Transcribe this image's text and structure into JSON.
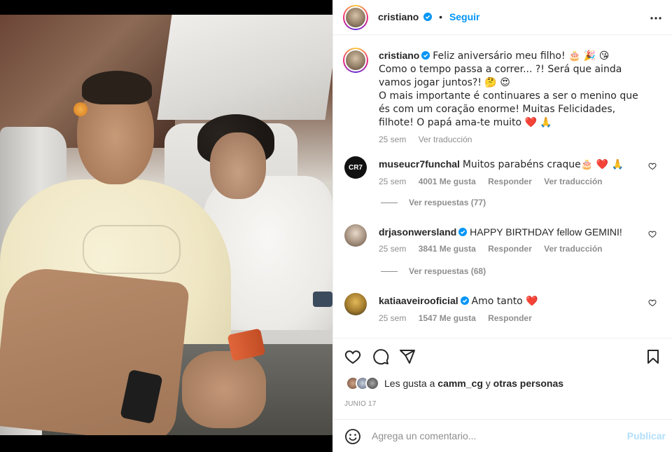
{
  "post": {
    "photo_alt": "",
    "author": "cristiano",
    "follow_label": "Seguir",
    "separator": "•",
    "caption": {
      "line1": "Feliz aniversário meu filho! 🎂 🎉 😘",
      "line2": "Como o tempo passa a correr... ?! Será que ainda vamos jogar juntos?! 🤔 😍",
      "line3": "O mais importante é continuares a ser o menino que és com um coração enorme! Muitas Felicidades, filhote! O papá ama-te muito ❤️ 🙏",
      "time": "25 sem",
      "translate": "Ver traducción"
    },
    "comments": [
      {
        "username": "museucr7funchal",
        "verified": false,
        "avatar_text": "CR7",
        "text": "Muitos parabéns craque🎂 ❤️ 🙏",
        "time": "25 sem",
        "likes": "4001 Me gusta",
        "reply": "Responder",
        "translate": "Ver traducción",
        "replies": "Ver respuestas (77)"
      },
      {
        "username": "drjasonwersland",
        "verified": true,
        "text": "HAPPY BIRTHDAY fellow GEMINI!",
        "time": "25 sem",
        "likes": "3841 Me gusta",
        "reply": "Responder",
        "translate": "Ver traducción",
        "replies": "Ver respuestas (68)"
      },
      {
        "username": "katiaaveirooficial",
        "verified": true,
        "text": "Amo tanto ❤️",
        "time": "25 sem",
        "likes": "1547 Me gusta",
        "reply": "Responder"
      }
    ],
    "likes": {
      "prefix": "Les gusta a",
      "user": "camm_cg",
      "conj": "y",
      "others": "otras personas"
    },
    "date": "JUNIO 17",
    "add_comment": {
      "placeholder": "Agrega un comentario...",
      "publish": "Publicar"
    }
  },
  "icons": {
    "verified": "verified-icon",
    "more": "more-icon",
    "heart": "heart-icon",
    "comment": "comment-icon",
    "share": "share-icon",
    "save": "bookmark-icon",
    "emoji": "emoji-icon"
  },
  "colors": {
    "accent": "#0095f6",
    "verified": "#0095f6",
    "muted": "#8e8e8e",
    "publish_disabled": "#b2dffc",
    "heart": "#ed4956"
  }
}
